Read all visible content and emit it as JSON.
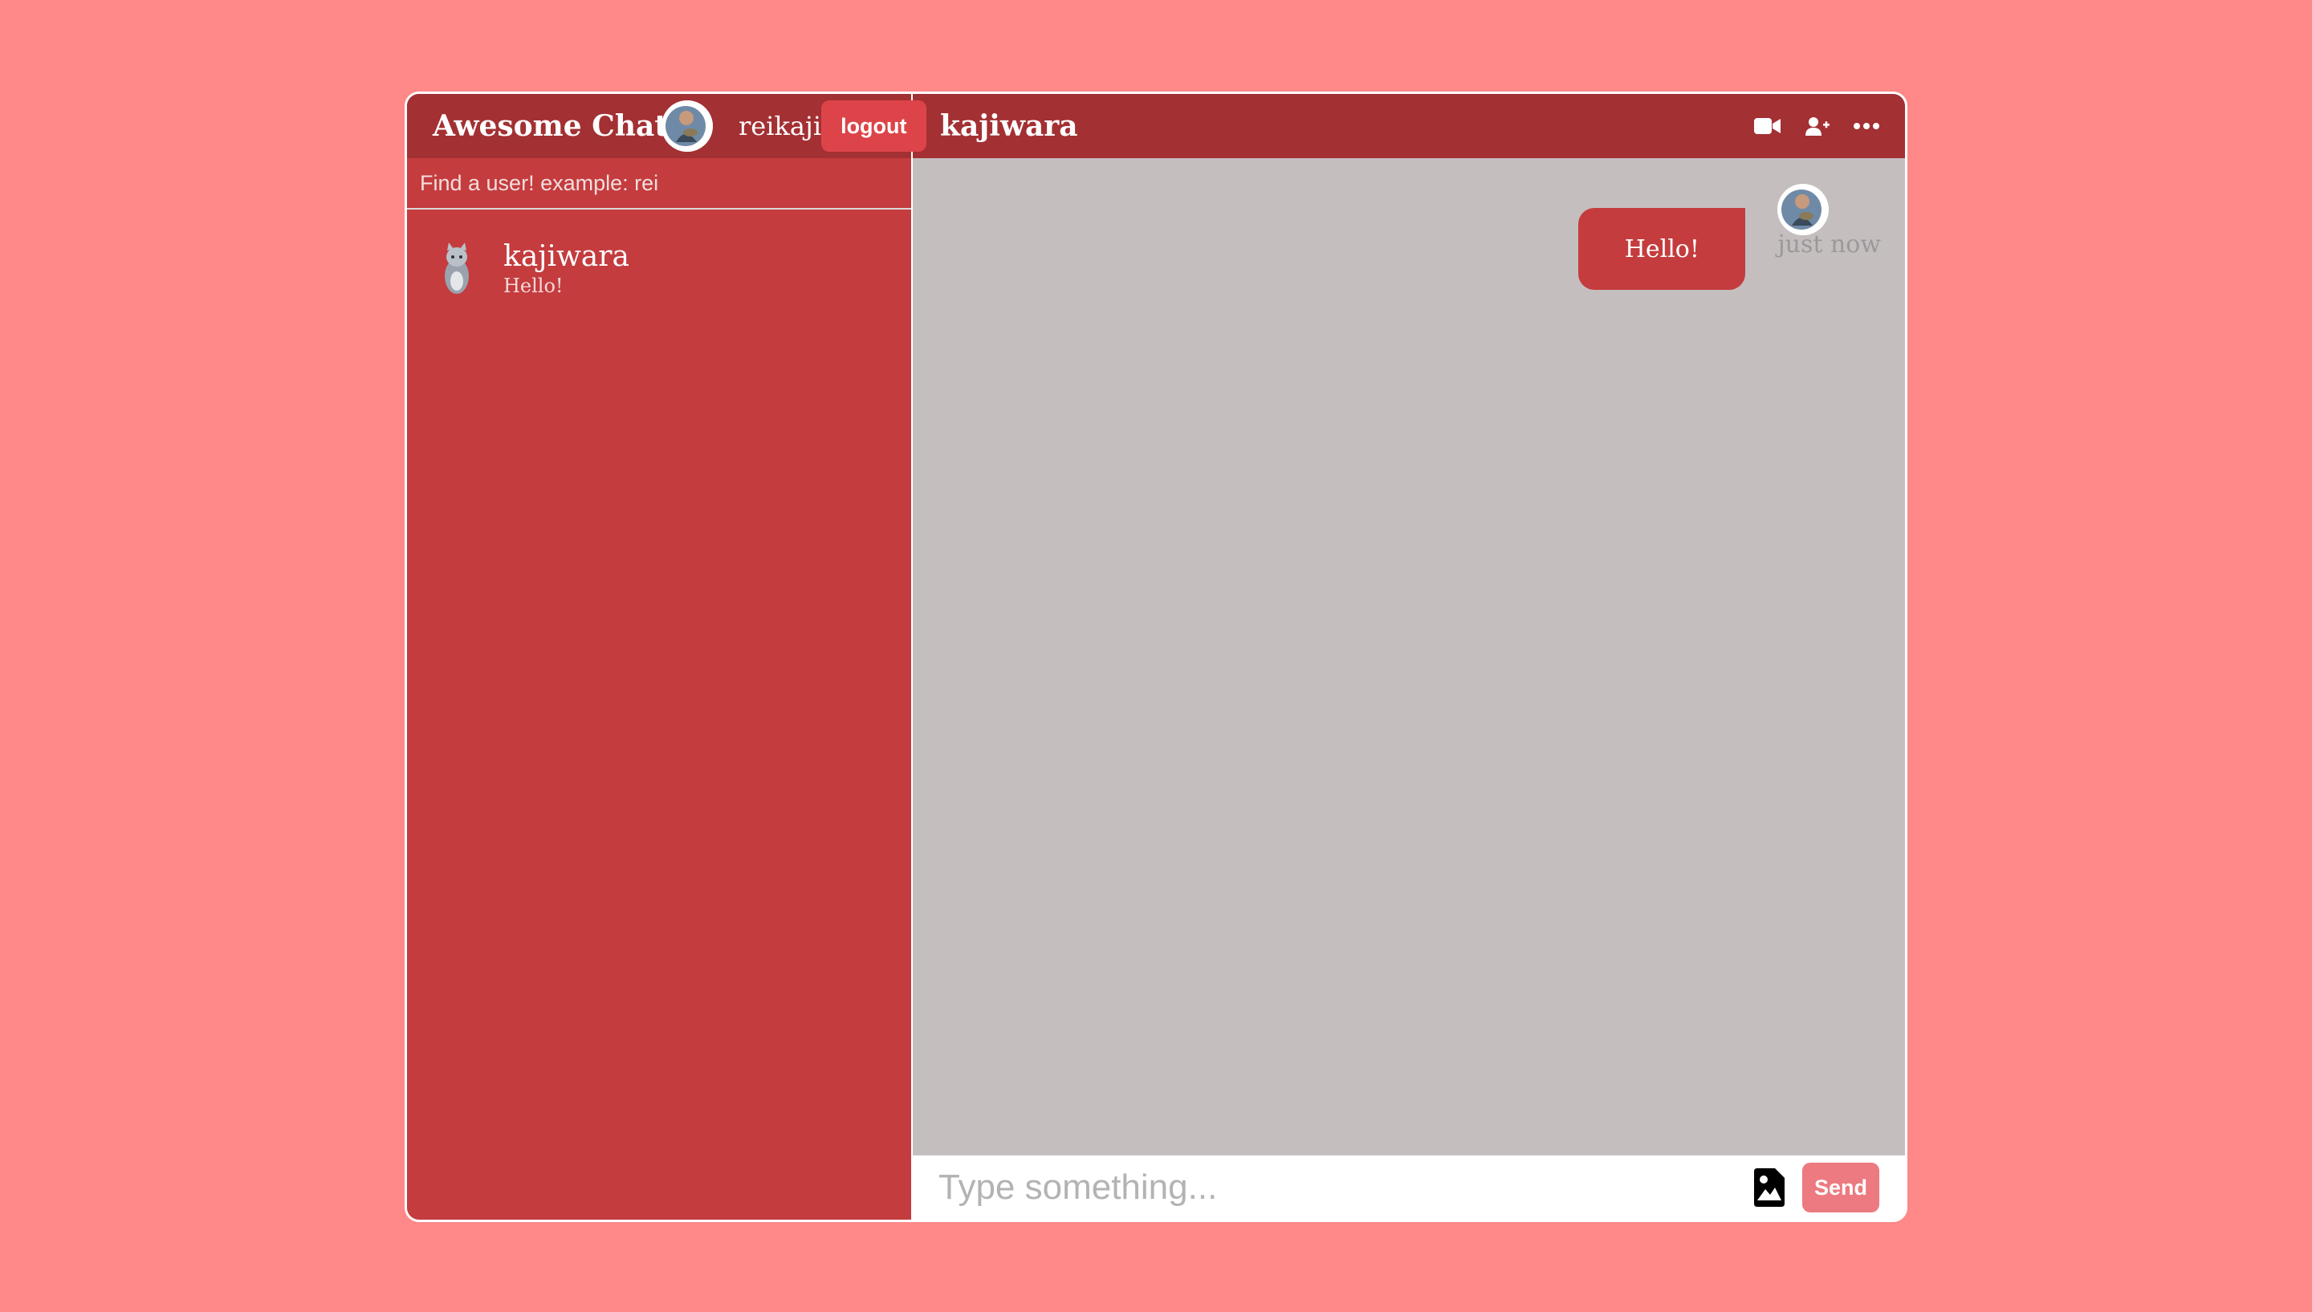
{
  "sidebar": {
    "app_title": "Awesome Chat",
    "current_user": "reikaji",
    "logout_label": "logout",
    "search_placeholder": "Find a user! example: rei",
    "chats": [
      {
        "name": "kajiwara",
        "last_message": "Hello!"
      }
    ]
  },
  "chat": {
    "title": "kajiwara",
    "icons": [
      "video-camera-icon",
      "add-user-icon",
      "more-icon"
    ],
    "messages": [
      {
        "text": "Hello!",
        "time": "just now",
        "owner": true
      }
    ],
    "composer_placeholder": "Type something...",
    "send_label": "Send"
  },
  "colors": {
    "background": "#ff8888",
    "header": "#a33033",
    "sidebar": "#c43c3e",
    "messages_bg": "#c5bebf",
    "bubble": "#c43c3e",
    "send_button": "#ec7a80"
  }
}
